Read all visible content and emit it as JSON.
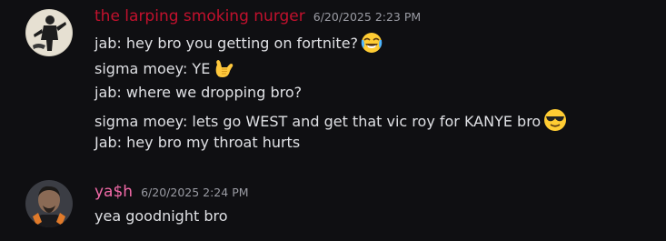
{
  "messages": [
    {
      "username": "the larping smoking nurger",
      "username_color": "#c1112d",
      "timestamp": "6/20/2025 2:23 PM",
      "avatar_icon": "silhouette-figure-avatar",
      "lines": [
        {
          "text": "jab: hey bro you getting on fortnite?",
          "emoji": "joy-emoji"
        },
        {
          "text": "sigma moey: YE",
          "emoji": "call-me-hand-emoji"
        },
        {
          "text": "jab: where we dropping bro?",
          "emoji": ""
        },
        {
          "text": "sigma moey: lets go WEST and get that vic roy for KANYE bro",
          "emoji": "sunglasses-emoji"
        },
        {
          "text": "Jab: hey bro my throat hurts",
          "emoji": ""
        }
      ]
    },
    {
      "username": "ya$h",
      "username_color": "#f26aa8",
      "timestamp": "6/20/2025 2:24 PM",
      "avatar_icon": "person-photo-avatar",
      "lines": [
        {
          "text": "yea goodnight bro",
          "emoji": ""
        }
      ]
    }
  ]
}
